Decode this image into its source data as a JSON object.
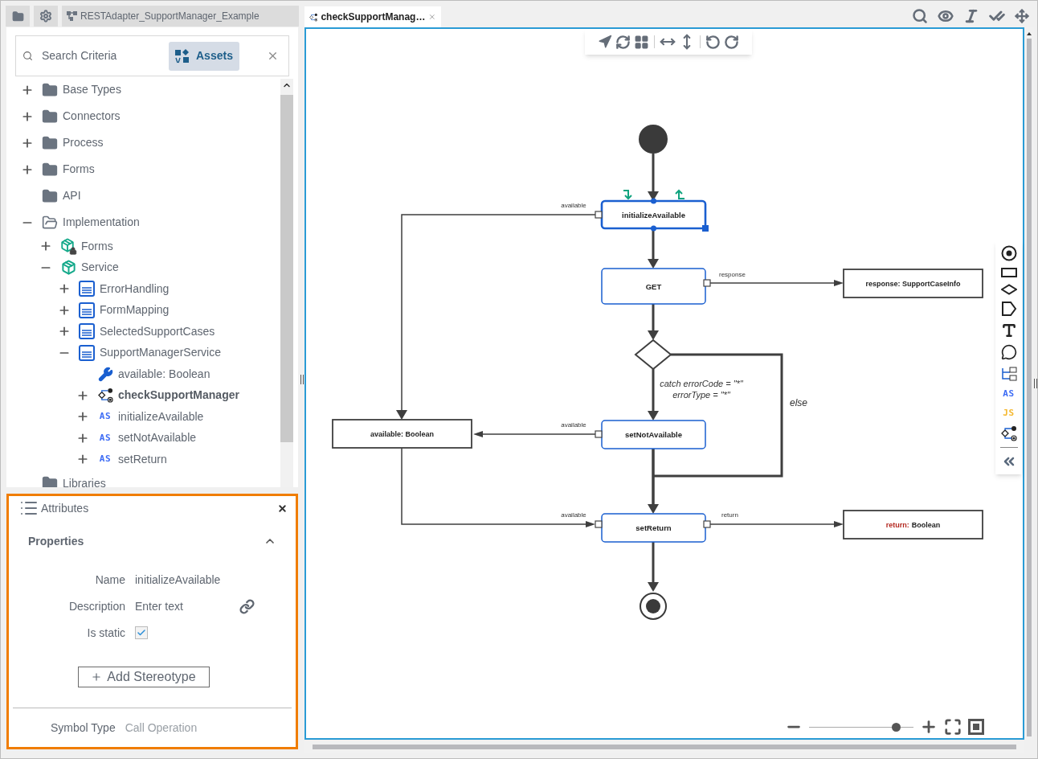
{
  "project_tab": {
    "title": "RESTAdapter_SupportManager_Example"
  },
  "search": {
    "placeholder": "Search Criteria",
    "filter": {
      "label": "Assets",
      "selected": true
    }
  },
  "tree": [
    {
      "label": "Base Types",
      "kind": "folder",
      "expanded": false,
      "selected": false
    },
    {
      "label": "Connectors",
      "kind": "folder",
      "expanded": false,
      "selected": false
    },
    {
      "label": "Process",
      "kind": "folder",
      "expanded": false,
      "selected": false
    },
    {
      "label": "Forms",
      "kind": "folder",
      "expanded": false,
      "selected": false
    },
    {
      "label": "API",
      "kind": "folder",
      "selected": false
    },
    {
      "label": "Implementation",
      "kind": "folder-open",
      "expanded": true,
      "selected": false,
      "children": [
        {
          "label": "Forms",
          "kind": "package-locked",
          "expanded": false,
          "selected": false
        },
        {
          "label": "Service",
          "kind": "package",
          "expanded": true,
          "selected": false,
          "children": [
            {
              "label": "ErrorHandling",
              "kind": "class",
              "expanded": false,
              "selected": false
            },
            {
              "label": "FormMapping",
              "kind": "class",
              "expanded": false,
              "selected": false
            },
            {
              "label": "SelectedSupportCases",
              "kind": "class",
              "expanded": false,
              "selected": false
            },
            {
              "label": "SupportManagerService",
              "kind": "class",
              "expanded": true,
              "selected": false,
              "children": [
                {
                  "label": "available: Boolean",
                  "kind": "attribute",
                  "selected": false
                },
                {
                  "label": "checkSupportManager",
                  "kind": "process",
                  "expanded": false,
                  "selected": true
                },
                {
                  "label": "initializeAvailable",
                  "kind": "script",
                  "badge": "AS",
                  "expanded": false,
                  "selected": false
                },
                {
                  "label": "setNotAvailable",
                  "kind": "script",
                  "badge": "AS",
                  "expanded": false,
                  "selected": false
                },
                {
                  "label": "setReturn",
                  "kind": "script",
                  "badge": "AS",
                  "expanded": false,
                  "selected": false
                }
              ]
            }
          ]
        }
      ]
    },
    {
      "label": "Libraries",
      "kind": "folder",
      "selected": false
    }
  ],
  "attributes": {
    "title": "Attributes",
    "section": {
      "title": "Properties",
      "expanded": true
    },
    "fields": [
      {
        "kind": "text",
        "label": "Name",
        "value": "initializeAvailable"
      },
      {
        "kind": "text",
        "label": "Description",
        "placeholder": "Enter text",
        "link": true
      },
      {
        "kind": "checkbox",
        "label": "Is static",
        "checked": true
      }
    ],
    "add_button": "Add Stereotype",
    "symbol_type": {
      "label": "Symbol Type",
      "value": "Call Operation"
    }
  },
  "editor_tab": {
    "title": "checkSupportManag…",
    "selected": true
  },
  "diagram": {
    "actions": [
      {
        "name": "initializeAvailable",
        "selected": true
      },
      {
        "name": "GET",
        "selected": false
      },
      {
        "name": "setNotAvailable",
        "selected": false
      },
      {
        "name": "setReturn",
        "selected": false
      }
    ],
    "objects": [
      {
        "parts": [
          {
            "text": "available: Boolean",
            "highlight": false
          }
        ]
      },
      {
        "parts": [
          {
            "text": "response: SupportCaseInfo",
            "highlight": false
          }
        ]
      },
      {
        "parts": [
          {
            "text": "return:",
            "highlight": true
          },
          {
            "text": "Boolean",
            "highlight": false
          }
        ]
      }
    ],
    "pin_labels": [
      "available",
      "response",
      "available",
      "available",
      "return"
    ],
    "guard": [
      "catch errorCode = \"*\"",
      "errorType = \"*\""
    ],
    "else_label": "else"
  },
  "palette": [
    {
      "kind": "initial"
    },
    {
      "kind": "action"
    },
    {
      "kind": "decision"
    },
    {
      "kind": "signal"
    },
    {
      "kind": "text"
    },
    {
      "kind": "comment"
    },
    {
      "kind": "structure"
    },
    {
      "kind": "script",
      "label": "AS",
      "color": "#3d6cf5"
    },
    {
      "kind": "script",
      "label": "JS",
      "color": "#f5b82e"
    },
    {
      "kind": "process"
    },
    {
      "kind": "collapse"
    }
  ],
  "zoom": {
    "level": 0.83
  }
}
